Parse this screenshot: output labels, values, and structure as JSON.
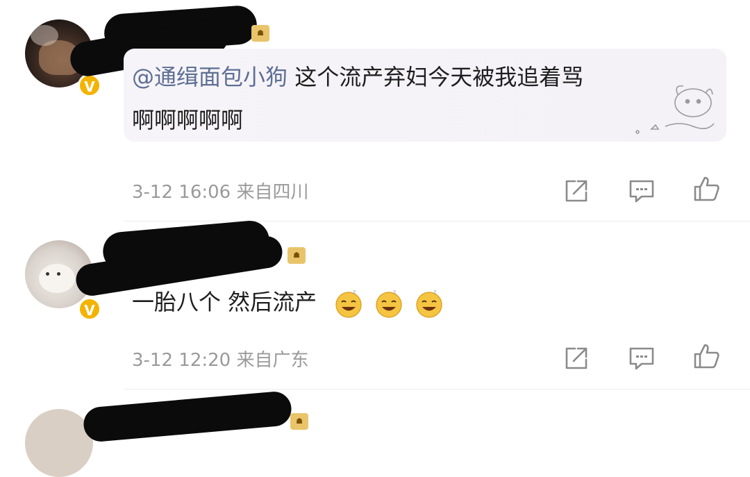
{
  "comments": [
    {
      "mention": "@通缉面包小狗",
      "text_line1": " 这个流产弃妇今天被我追着骂",
      "text_line2": "啊啊啊啊啊",
      "meta": "3-12 16:06 来自四川",
      "badge": "V"
    },
    {
      "text": "一胎八个 然后流产",
      "meta": "3-12 12:20 来自广东",
      "badge": "V"
    }
  ],
  "icons": {
    "share": "share-icon",
    "comment": "comment-icon",
    "like": "thumbs-up-icon",
    "emoji": "drowsy-smile-emoji"
  },
  "colors": {
    "mention": "#5d6f93",
    "meta": "#9a9a9a",
    "verified_badge": "#f3b300"
  }
}
